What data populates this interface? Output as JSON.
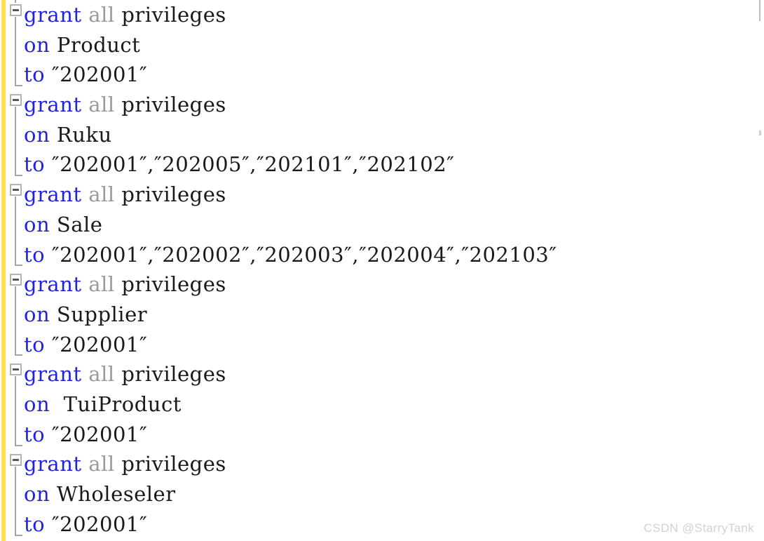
{
  "editor": {
    "background_color": "#ffffff",
    "font_size_px": 29,
    "line_height_px": 42.7,
    "change_stripe_color": "#ffe14d",
    "fold_marker_color": "#a6a6a6",
    "keyword_color": "#2222dd",
    "dim_keyword_color": "#9a9a9a",
    "text_color": "#1a1a1a"
  },
  "gutter": {
    "fold_icon_name": "fold-collapse-minus-icon",
    "fold_icon_glyph": "−"
  },
  "scrollbar": {
    "thumb_color": "#b9bcc2",
    "marker_color": "#c9cde8"
  },
  "watermark": {
    "text": "CSDN @StarryTank"
  },
  "code_blocks": [
    {
      "line1": {
        "kw": "grant",
        "dim": " all ",
        "plain": "privileges"
      },
      "line2": {
        "kw": "on",
        "plain": " Product"
      },
      "line3": {
        "kw": "to",
        "plain": " ″202001″"
      }
    },
    {
      "line1": {
        "kw": "grant",
        "dim": " all ",
        "plain": "privileges"
      },
      "line2": {
        "kw": "on",
        "plain": " Ruku"
      },
      "line3": {
        "kw": "to",
        "plain": " ″202001″,″202005″,″202101″,″202102″"
      }
    },
    {
      "line1": {
        "kw": "grant",
        "dim": " all ",
        "plain": "privileges"
      },
      "line2": {
        "kw": "on",
        "plain": " Sale"
      },
      "line3": {
        "kw": "to",
        "plain": " ″202001″,″202002″,″202003″,″202004″,″202103″"
      }
    },
    {
      "line1": {
        "kw": "grant",
        "dim": " all ",
        "plain": "privileges"
      },
      "line2": {
        "kw": "on",
        "plain": " Supplier"
      },
      "line3": {
        "kw": "to",
        "plain": " ″202001″"
      }
    },
    {
      "line1": {
        "kw": "grant",
        "dim": " all ",
        "plain": "privileges"
      },
      "line2": {
        "kw": "on",
        "plain": "  TuiProduct"
      },
      "line3": {
        "kw": "to",
        "plain": " ″202001″"
      }
    },
    {
      "line1": {
        "kw": "grant",
        "dim": " all ",
        "plain": "privileges"
      },
      "line2": {
        "kw": "on",
        "plain": " Wholeseler"
      },
      "line3": {
        "kw": "to",
        "plain": " ″202001″"
      }
    }
  ]
}
